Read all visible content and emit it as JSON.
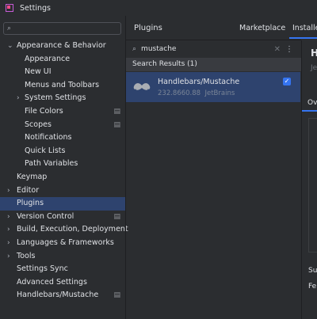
{
  "window": {
    "title": "Settings"
  },
  "sidebar": {
    "search_placeholder": "",
    "items": [
      {
        "label": "Appearance & Behavior",
        "level": 0,
        "expanded": true,
        "chevron": "chevron-down"
      },
      {
        "label": "Appearance",
        "level": 1
      },
      {
        "label": "New UI",
        "level": 1
      },
      {
        "label": "Menus and Toolbars",
        "level": 1
      },
      {
        "label": "System Settings",
        "level": 1,
        "chevron": "chevron-right"
      },
      {
        "label": "File Colors",
        "level": 1,
        "icon": "project-level-icon"
      },
      {
        "label": "Scopes",
        "level": 1,
        "icon": "project-level-icon"
      },
      {
        "label": "Notifications",
        "level": 1
      },
      {
        "label": "Quick Lists",
        "level": 1
      },
      {
        "label": "Path Variables",
        "level": 1
      },
      {
        "label": "Keymap",
        "level": 0
      },
      {
        "label": "Editor",
        "level": 0,
        "chevron": "chevron-right"
      },
      {
        "label": "Plugins",
        "level": 0,
        "selected": true
      },
      {
        "label": "Version Control",
        "level": 0,
        "chevron": "chevron-right",
        "icon": "project-level-icon"
      },
      {
        "label": "Build, Execution, Deployment",
        "level": 0,
        "chevron": "chevron-right"
      },
      {
        "label": "Languages & Frameworks",
        "level": 0,
        "chevron": "chevron-right"
      },
      {
        "label": "Tools",
        "level": 0,
        "chevron": "chevron-right"
      },
      {
        "label": "Settings Sync",
        "level": 0
      },
      {
        "label": "Advanced Settings",
        "level": 0
      },
      {
        "label": "Handlebars/Mustache",
        "level": 0,
        "icon": "project-level-icon"
      }
    ]
  },
  "plugins": {
    "title": "Plugins",
    "tabs": {
      "marketplace": "Marketplace",
      "installed": "Installed"
    },
    "search_value": "mustache",
    "results_header": "Search Results (1)",
    "results": [
      {
        "name": "Handlebars/Mustache",
        "version": "232.8660.88",
        "vendor": "JetBrains",
        "enabled": true
      }
    ]
  },
  "detail": {
    "heading_partial": "H",
    "subtitle_partial": "Je",
    "tab_partial": "Ov",
    "row1_partial": "Su",
    "row2_partial": "Fe"
  },
  "colors": {
    "accent": "#3574f0",
    "selection": "#2e436e",
    "background": "#2b2d30"
  }
}
